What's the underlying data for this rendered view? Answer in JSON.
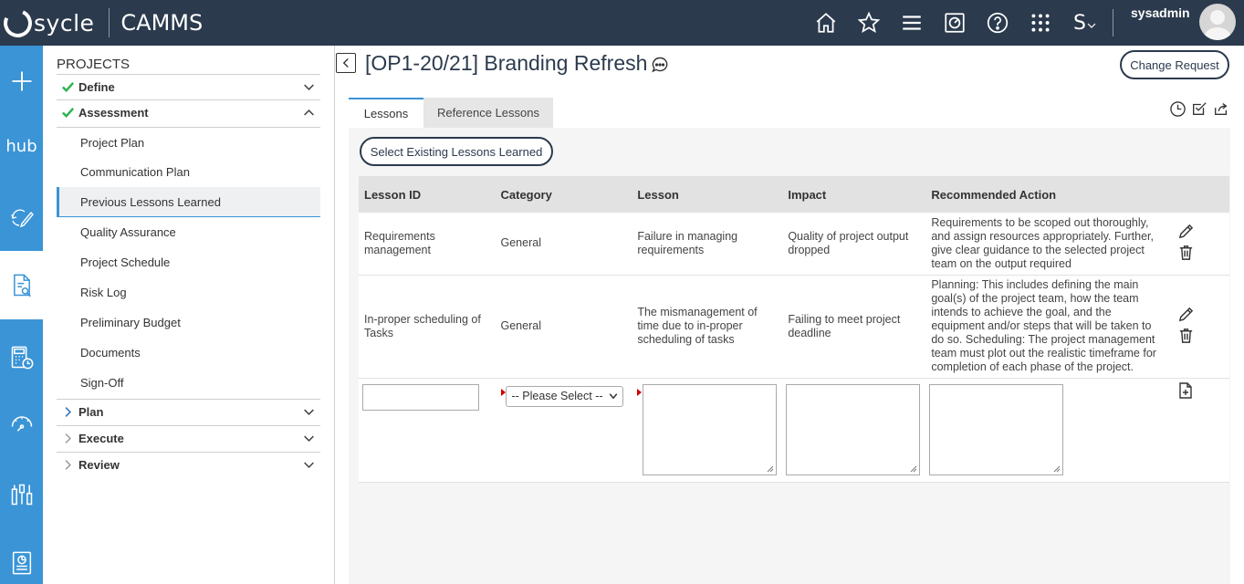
{
  "header": {
    "logo_text": "sycle",
    "app_name": "CAMMS",
    "username": "sysadmin",
    "icons": [
      "home-icon",
      "star-icon",
      "menu-icon",
      "dashboard-icon",
      "help-icon",
      "apps-grid-icon",
      "s-dropdown-icon"
    ],
    "s_label": "S"
  },
  "rail": {
    "hub_label": "hub",
    "icons": [
      "plus-icon",
      "hub-icon",
      "refresh-edit-icon",
      "document-search-icon",
      "calculator-clock-icon",
      "gauge-icon",
      "settings-sliders-icon",
      "report-icon"
    ]
  },
  "sidenav": {
    "title": "PROJECTS",
    "sections": [
      {
        "label": "Define",
        "state": "complete",
        "expanded": false
      },
      {
        "label": "Assessment",
        "state": "complete",
        "expanded": true
      },
      {
        "label": "Plan",
        "state": "pending",
        "expanded": false
      },
      {
        "label": "Execute",
        "state": "pending",
        "expanded": false
      },
      {
        "label": "Review",
        "state": "pending",
        "expanded": false
      }
    ],
    "assessment_items": [
      "Project Plan",
      "Communication Plan",
      "Previous Lessons Learned",
      "Quality Assurance",
      "Project Schedule",
      "Risk Log",
      "Preliminary Budget",
      "Documents",
      "Sign-Off"
    ],
    "active_item": "Previous Lessons Learned"
  },
  "main": {
    "title": "[OP1-20/21] Branding Refresh",
    "change_request_label": "Change Request",
    "tabs": [
      {
        "label": "Lessons",
        "active": true
      },
      {
        "label": "Reference Lessons",
        "active": false
      }
    ],
    "select_existing_label": "Select Existing Lessons Learned",
    "table": {
      "columns": [
        "Lesson ID",
        "Category",
        "Lesson",
        "Impact",
        "Recommended Action"
      ],
      "rows": [
        {
          "lesson_id": "Requirements management",
          "category": "General",
          "lesson": "Failure in managing requirements",
          "impact": "Quality of project output dropped",
          "action": "Requirements to be scoped out thoroughly, and assign resources appropriately. Further, give clear guidance to the selected project team on the output required"
        },
        {
          "lesson_id": "In-proper scheduling of Tasks",
          "category": "General",
          "lesson": "The mismanagement of time due to in-proper scheduling of tasks",
          "impact": "Failing to meet project deadline",
          "action": "Planning: This includes defining the main goal(s) of the project team, how the team intends to achieve the goal, and the equipment and/or steps that will be taken to do so. Scheduling: The project management team must plot out the realistic timeframe for completion of each phase of the project."
        }
      ],
      "new_row": {
        "category_select_value": "-- Please Select --"
      }
    }
  },
  "colors": {
    "topbar": "#2b3a4d",
    "rail": "#3a94d6",
    "check": "#2bb24c",
    "required": "#d10000"
  }
}
